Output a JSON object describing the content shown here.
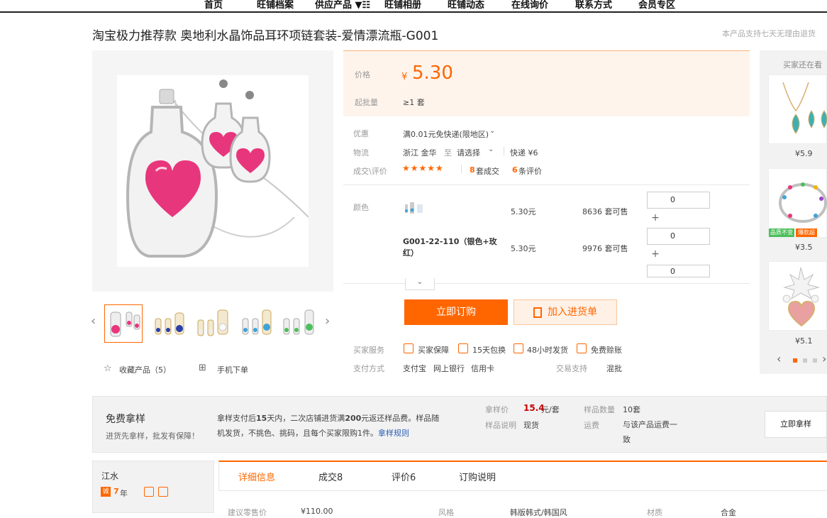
{
  "nav": [
    "首页",
    "旺铺档案",
    "供应产品 ▼☷",
    "旺铺相册",
    "旺铺动态",
    "在线询价",
    "联系方式",
    "会员专区"
  ],
  "title": "淘宝极力推荐款 奥地利水晶饰品耳环项链套装-爱情漂流瓶-G001",
  "notice": "本产品支持七天无理由退货",
  "price": {
    "label": "价格",
    "currency": "¥",
    "value": "5.30",
    "moq_label": "起批量",
    "moq_value": "≥1 套"
  },
  "info": {
    "promo_label": "优惠",
    "promo_value": "满0.01元免快递(限地区)",
    "logistics_label": "物流",
    "logistics_from": "浙江 金华",
    "logistics_to_word": "至",
    "logistics_select": "请选择",
    "logistics_express": "快递 ¥6",
    "deals_label": "成交\\评价",
    "deals_count": "8",
    "deals_unit": "套成交",
    "reviews_count": "6",
    "reviews_unit": "条评价"
  },
  "color": {
    "label": "颜色",
    "rows": [
      {
        "name": "",
        "price": "5.30元",
        "stock": "8636 套可售",
        "qty": "0"
      },
      {
        "name": "G001-22-110（银色+玫红）",
        "price": "5.30元",
        "stock": "9976 套可售",
        "qty": "0"
      },
      {
        "name": "",
        "price": "",
        "stock": "",
        "qty": "0"
      }
    ]
  },
  "buttons": {
    "order": "立即订购",
    "cart": "加入进货单",
    "sample": "立即拿样"
  },
  "services": {
    "label": "买家服务",
    "items": [
      "买家保障",
      "15天包换",
      "48小时发货",
      "免费赊账"
    ]
  },
  "payment": {
    "label": "支付方式",
    "items": [
      "支付宝",
      "网上银行",
      "信用卡"
    ],
    "trade_label": "交易支持",
    "trade_value": "混批"
  },
  "left_actions": {
    "favorite": "收藏产品（5）",
    "mobile": "手机下单"
  },
  "right_panel": {
    "title": "买家还在看",
    "items": [
      {
        "price": "¥5.9"
      },
      {
        "price": "¥3.5",
        "badge1": "品质不变",
        "badge2": "爆款超"
      },
      {
        "price": "¥5.1"
      }
    ]
  },
  "sample": {
    "title": "免费拿样",
    "subtitle": "进货先拿样，批发有保障！",
    "desc_a": "拿样支付后",
    "desc_days": "15",
    "desc_b": "天内，二次店铺进货满",
    "desc_amount": "200",
    "desc_c": "元返还样品费。样品随机发货，不挑色、挑码，且每个买家限购1件。",
    "rules_link": "拿样规则",
    "price_label": "拿样价",
    "price_value": "15.4",
    "price_unit": "元/套",
    "count_label": "样品数量",
    "count_value": "10套",
    "desc_label": "样品说明",
    "desc_value": "现货",
    "freight_label": "运费",
    "freight_value": "与该产品运费一致"
  },
  "shop": {
    "name": "江水",
    "years": "7",
    "years_unit": "年"
  },
  "tabs": [
    "详细信息",
    "成交8",
    "评价6",
    "订购说明"
  ],
  "details_row": {
    "k1": "建议零售价",
    "v1": "¥110.00",
    "k2": "风格",
    "v2": "韩版韩式/韩国风",
    "k3": "材质",
    "v3": "合金"
  },
  "colors": {
    "accent": "#ff6600",
    "price_bg": "#fef4ec",
    "sample_price": "#cc0000"
  }
}
